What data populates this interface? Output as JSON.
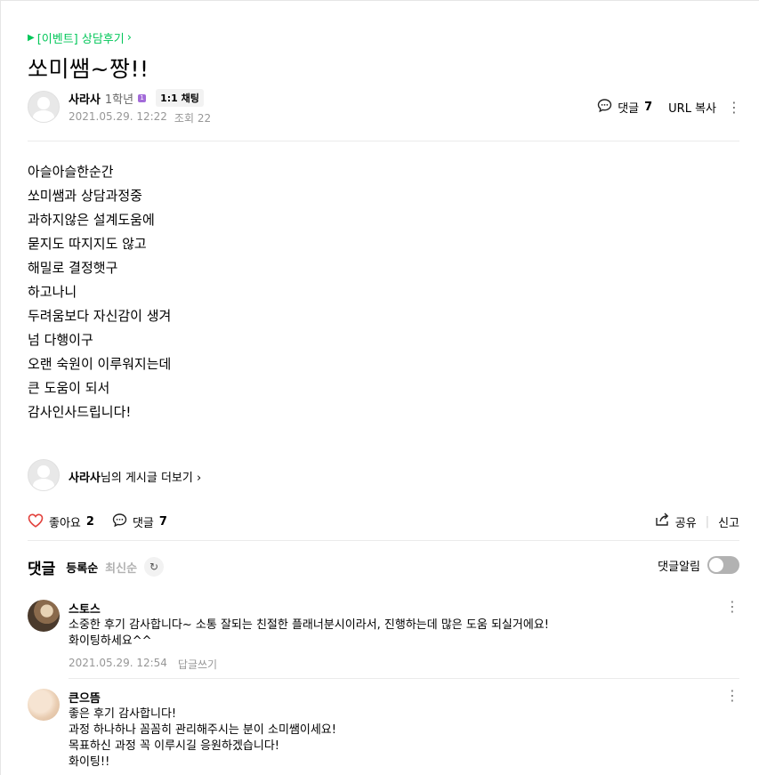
{
  "post": {
    "category": "[이벤트] 상담후기",
    "title": "쏘미쌤~짱!!",
    "author": "사라사",
    "grade": "1학년",
    "level_badge": "1",
    "chat_badge": "1:1 채팅",
    "date": "2021.05.29. 12:22",
    "views": "조회 22",
    "comment_label": "댓글",
    "comment_count": "7",
    "url_copy": "URL 복사",
    "content_lines": [
      "아슬아슬한순간",
      "쏘미쌤과 상담과정중",
      "과하지않은 설계도움에",
      "묻지도 따지지도 않고",
      "해밀로 결정햇구",
      "하고나니",
      "두려움보다 자신감이 생겨",
      "넘 다행이구",
      "오랜 숙원이 이루워지는데",
      "큰 도움이 되서",
      "감사인사드립니다!"
    ]
  },
  "more_posts": {
    "author": "사라사",
    "suffix": "님의 게시글 더보기"
  },
  "actions": {
    "like_label": "좋아요",
    "like_count": "2",
    "comment_label": "댓글",
    "comment_count": "7",
    "share": "공유",
    "report": "신고"
  },
  "comments_section": {
    "title": "댓글",
    "sort_register": "등록순",
    "sort_latest": "최신순",
    "notify_label": "댓글알림",
    "notify_on": false
  },
  "comments": [
    {
      "name": "스토스",
      "lines": [
        "소중한 후기 감사합니다~ 소통 잘되는 친절한 플래너분시이라서, 진행하는데 많은 도움 되실거에요!",
        "화이팅하세요^^"
      ],
      "date": "2021.05.29. 12:54",
      "reply": "답글쓰기"
    },
    {
      "name": "큰으뜸",
      "lines": [
        "좋은 후기 감사합니다!",
        "과정 하나하나 꼼꼼히 관리해주시는 분이 소미쌤이세요!",
        "목표하신 과정 꼭 이루시길 응원하겠습니다!",
        "화이팅!!"
      ]
    }
  ],
  "colors": {
    "accent_green": "#03c75a",
    "heart_red": "#e2413c",
    "level_purple": "#a36bd9"
  }
}
